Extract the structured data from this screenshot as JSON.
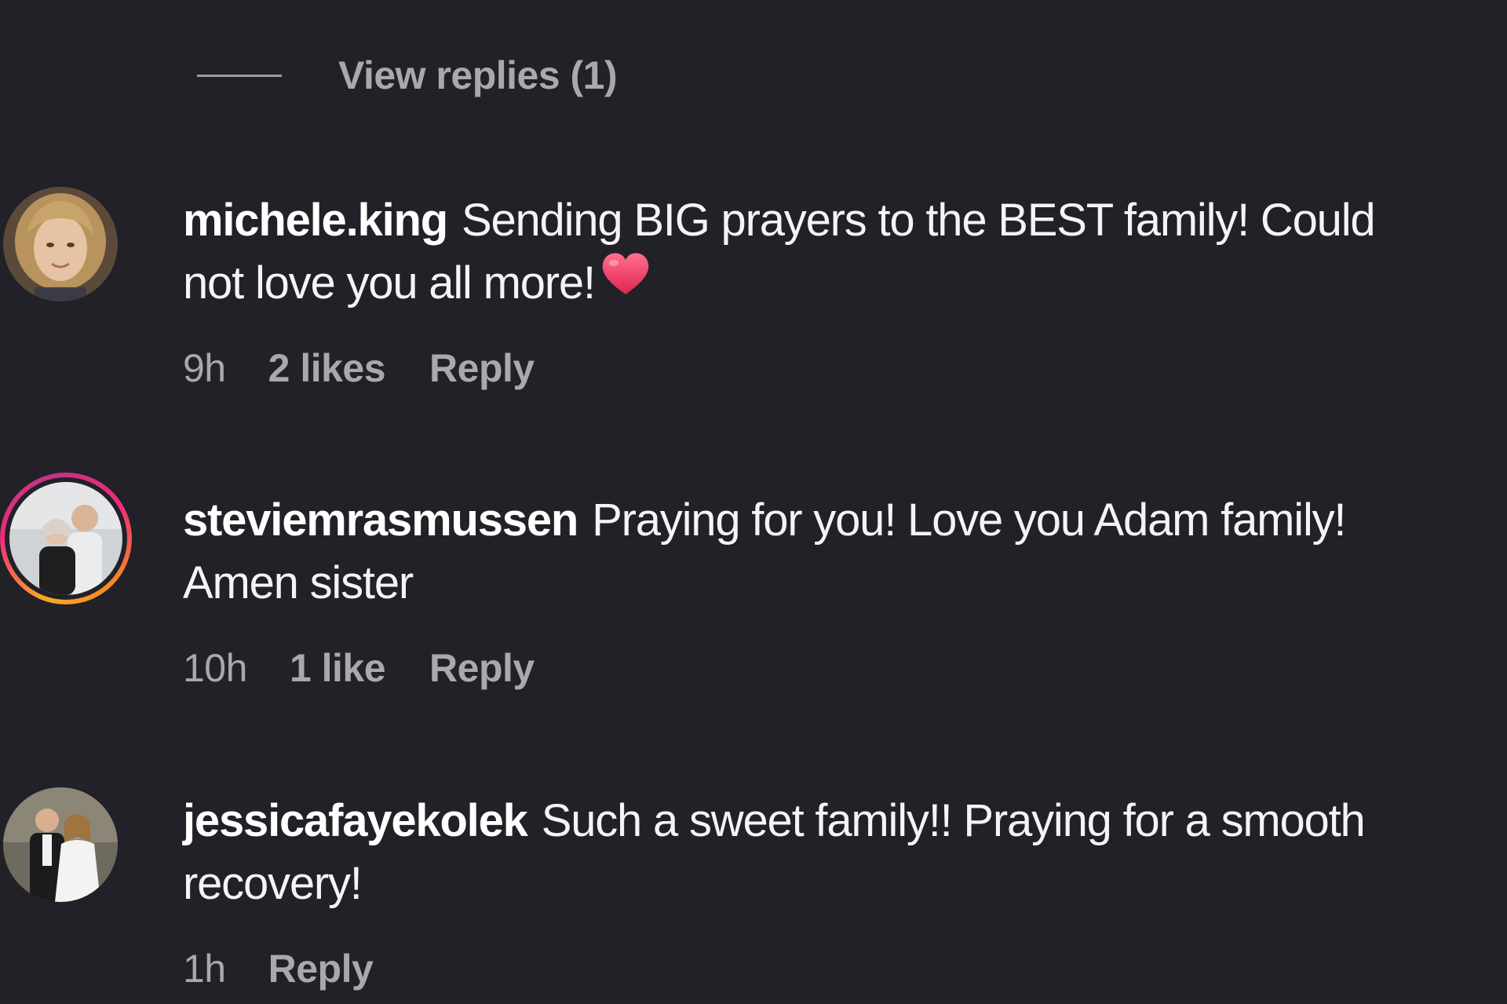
{
  "view_replies": {
    "label": "View replies (1)"
  },
  "comments": [
    {
      "username": "michele.king",
      "text_line1": "Sending BIG prayers to the BEST family! Could",
      "text_line2": "not love you all more!",
      "emoji": "red-heart",
      "time": "9h",
      "likes": "2 likes",
      "reply": "Reply",
      "avatar_has_story_ring": false
    },
    {
      "username": "steviemrasmussen",
      "text_line1": "Praying for you! Love you Adam family!",
      "text_line2": "Amen sister",
      "time": "10h",
      "likes": "1 like",
      "reply": "Reply",
      "avatar_has_story_ring": true
    },
    {
      "username": "jessicafayekolek",
      "text_line1": "Such a sweet family!! Praying for a smooth",
      "text_line2": "recovery!",
      "time": "1h",
      "likes": "",
      "reply": "Reply",
      "avatar_has_story_ring": false
    }
  ],
  "colors": {
    "background": "#212127",
    "primary_text": "#f4f4f4",
    "secondary_text": "#a8a8ad",
    "heart": "#f0476a"
  }
}
